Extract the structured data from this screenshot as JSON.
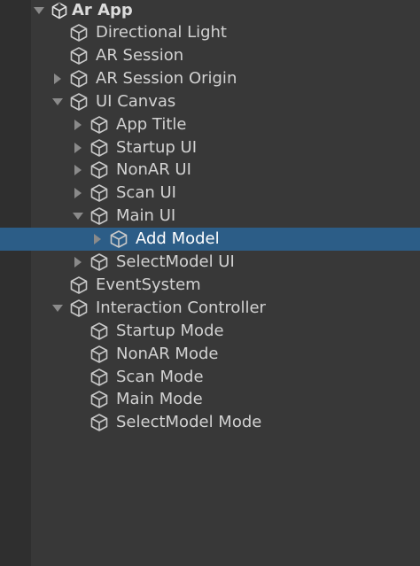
{
  "hierarchy": {
    "scene": {
      "label": "Ar App",
      "icon": "unity-scene-icon",
      "expanded": true
    },
    "items": [
      {
        "name": "directional-light",
        "label": "Directional Light",
        "depth": 1,
        "foldout": "none",
        "icon": "gameobject-cube-icon",
        "selected": false
      },
      {
        "name": "ar-session",
        "label": "AR Session",
        "depth": 1,
        "foldout": "none",
        "icon": "gameobject-cube-icon",
        "selected": false
      },
      {
        "name": "ar-session-origin",
        "label": "AR Session Origin",
        "depth": 1,
        "foldout": "collapsed",
        "icon": "gameobject-cube-icon",
        "selected": false
      },
      {
        "name": "ui-canvas",
        "label": "UI Canvas",
        "depth": 1,
        "foldout": "expanded",
        "icon": "gameobject-cube-icon",
        "selected": false
      },
      {
        "name": "app-title",
        "label": "App Title",
        "depth": 2,
        "foldout": "collapsed",
        "icon": "gameobject-cube-icon",
        "selected": false
      },
      {
        "name": "startup-ui",
        "label": "Startup UI",
        "depth": 2,
        "foldout": "collapsed",
        "icon": "gameobject-cube-icon",
        "selected": false
      },
      {
        "name": "nonar-ui",
        "label": "NonAR UI",
        "depth": 2,
        "foldout": "collapsed",
        "icon": "gameobject-cube-icon",
        "selected": false
      },
      {
        "name": "scan-ui",
        "label": "Scan UI",
        "depth": 2,
        "foldout": "collapsed",
        "icon": "gameobject-cube-icon",
        "selected": false
      },
      {
        "name": "main-ui",
        "label": "Main UI",
        "depth": 2,
        "foldout": "expanded",
        "icon": "gameobject-cube-icon",
        "selected": false
      },
      {
        "name": "add-model",
        "label": "Add Model",
        "depth": 3,
        "foldout": "collapsed",
        "icon": "gameobject-cube-icon",
        "selected": true
      },
      {
        "name": "selectmodel-ui",
        "label": "SelectModel UI",
        "depth": 2,
        "foldout": "collapsed",
        "icon": "gameobject-cube-icon",
        "selected": false
      },
      {
        "name": "eventsystem",
        "label": "EventSystem",
        "depth": 1,
        "foldout": "none",
        "icon": "gameobject-cube-icon",
        "selected": false
      },
      {
        "name": "interaction-controller",
        "label": "Interaction Controller",
        "depth": 1,
        "foldout": "expanded",
        "icon": "gameobject-cube-icon",
        "selected": false
      },
      {
        "name": "startup-mode",
        "label": "Startup Mode",
        "depth": 2,
        "foldout": "none",
        "icon": "gameobject-cube-icon",
        "selected": false
      },
      {
        "name": "nonar-mode",
        "label": "NonAR Mode",
        "depth": 2,
        "foldout": "none",
        "icon": "gameobject-cube-icon",
        "selected": false
      },
      {
        "name": "scan-mode",
        "label": "Scan Mode",
        "depth": 2,
        "foldout": "none",
        "icon": "gameobject-cube-icon",
        "selected": false
      },
      {
        "name": "main-mode",
        "label": "Main Mode",
        "depth": 2,
        "foldout": "none",
        "icon": "gameobject-cube-icon",
        "selected": false
      },
      {
        "name": "selectmodel-mode",
        "label": "SelectModel Mode",
        "depth": 2,
        "foldout": "none",
        "icon": "gameobject-cube-icon",
        "selected": false
      }
    ]
  },
  "colors": {
    "panel_background": "#383838",
    "left_strip": "#2f2f2f",
    "selection": "#2c5d87",
    "text": "#d2d2d2",
    "icon_stroke": "#c8c8c8",
    "foldout_arrow": "#8a8a8a"
  }
}
